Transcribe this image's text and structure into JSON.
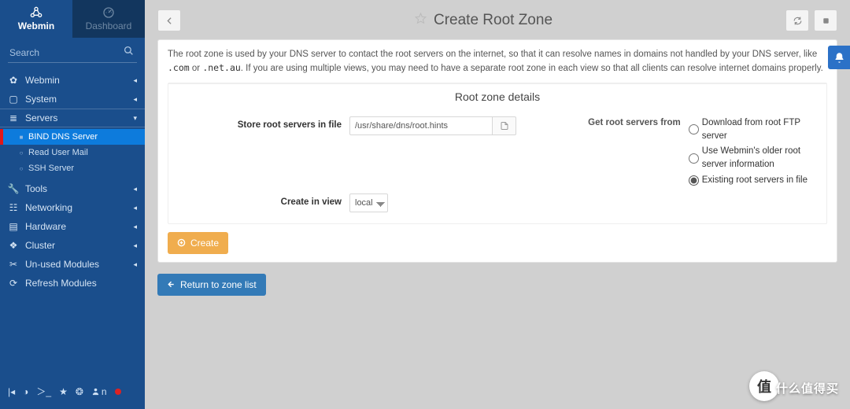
{
  "sidebar": {
    "tabs": {
      "webmin": "Webmin",
      "dashboard": "Dashboard"
    },
    "search_placeholder": "Search",
    "items": [
      {
        "icon": "gear",
        "label": "Webmin"
      },
      {
        "icon": "laptop",
        "label": "System"
      },
      {
        "icon": "server",
        "label": "Servers",
        "expanded": true,
        "children": [
          {
            "label": "BIND DNS Server",
            "active": true
          },
          {
            "label": "Read User Mail"
          },
          {
            "label": "SSH Server"
          }
        ]
      },
      {
        "icon": "wrench",
        "label": "Tools"
      },
      {
        "icon": "sitemap",
        "label": "Networking"
      },
      {
        "icon": "hdd",
        "label": "Hardware"
      },
      {
        "icon": "cubes",
        "label": "Cluster"
      },
      {
        "icon": "unlink",
        "label": "Un-used Modules"
      },
      {
        "icon": "refresh",
        "label": "Refresh Modules"
      }
    ],
    "toolbar_user": "n"
  },
  "header": {
    "title": "Create Root Zone"
  },
  "intro": {
    "part1": "The root zone is used by your DNS server to contact the root servers on the internet, so that it can resolve names in domains not handled by your DNS server, like ",
    "code1": ".com",
    "mid": " or ",
    "code2": ".net.au",
    "part2": ". If you are using multiple views, you may need to have a separate root zone in each view so that all clients can resolve internet domains properly."
  },
  "form": {
    "section_title": "Root zone details",
    "store_label": "Store root servers in file",
    "store_value": "/usr/share/dns/root.hints",
    "view_label": "Create in view",
    "view_value": "local",
    "servers_label": "Get root servers from",
    "radio1": "Download from root FTP server",
    "radio2": "Use Webmin's older root server information",
    "radio3": "Existing root servers in file",
    "create_btn": "Create"
  },
  "return_btn": "Return to zone list",
  "watermark": {
    "badge": "值",
    "text": "什么值得买"
  }
}
